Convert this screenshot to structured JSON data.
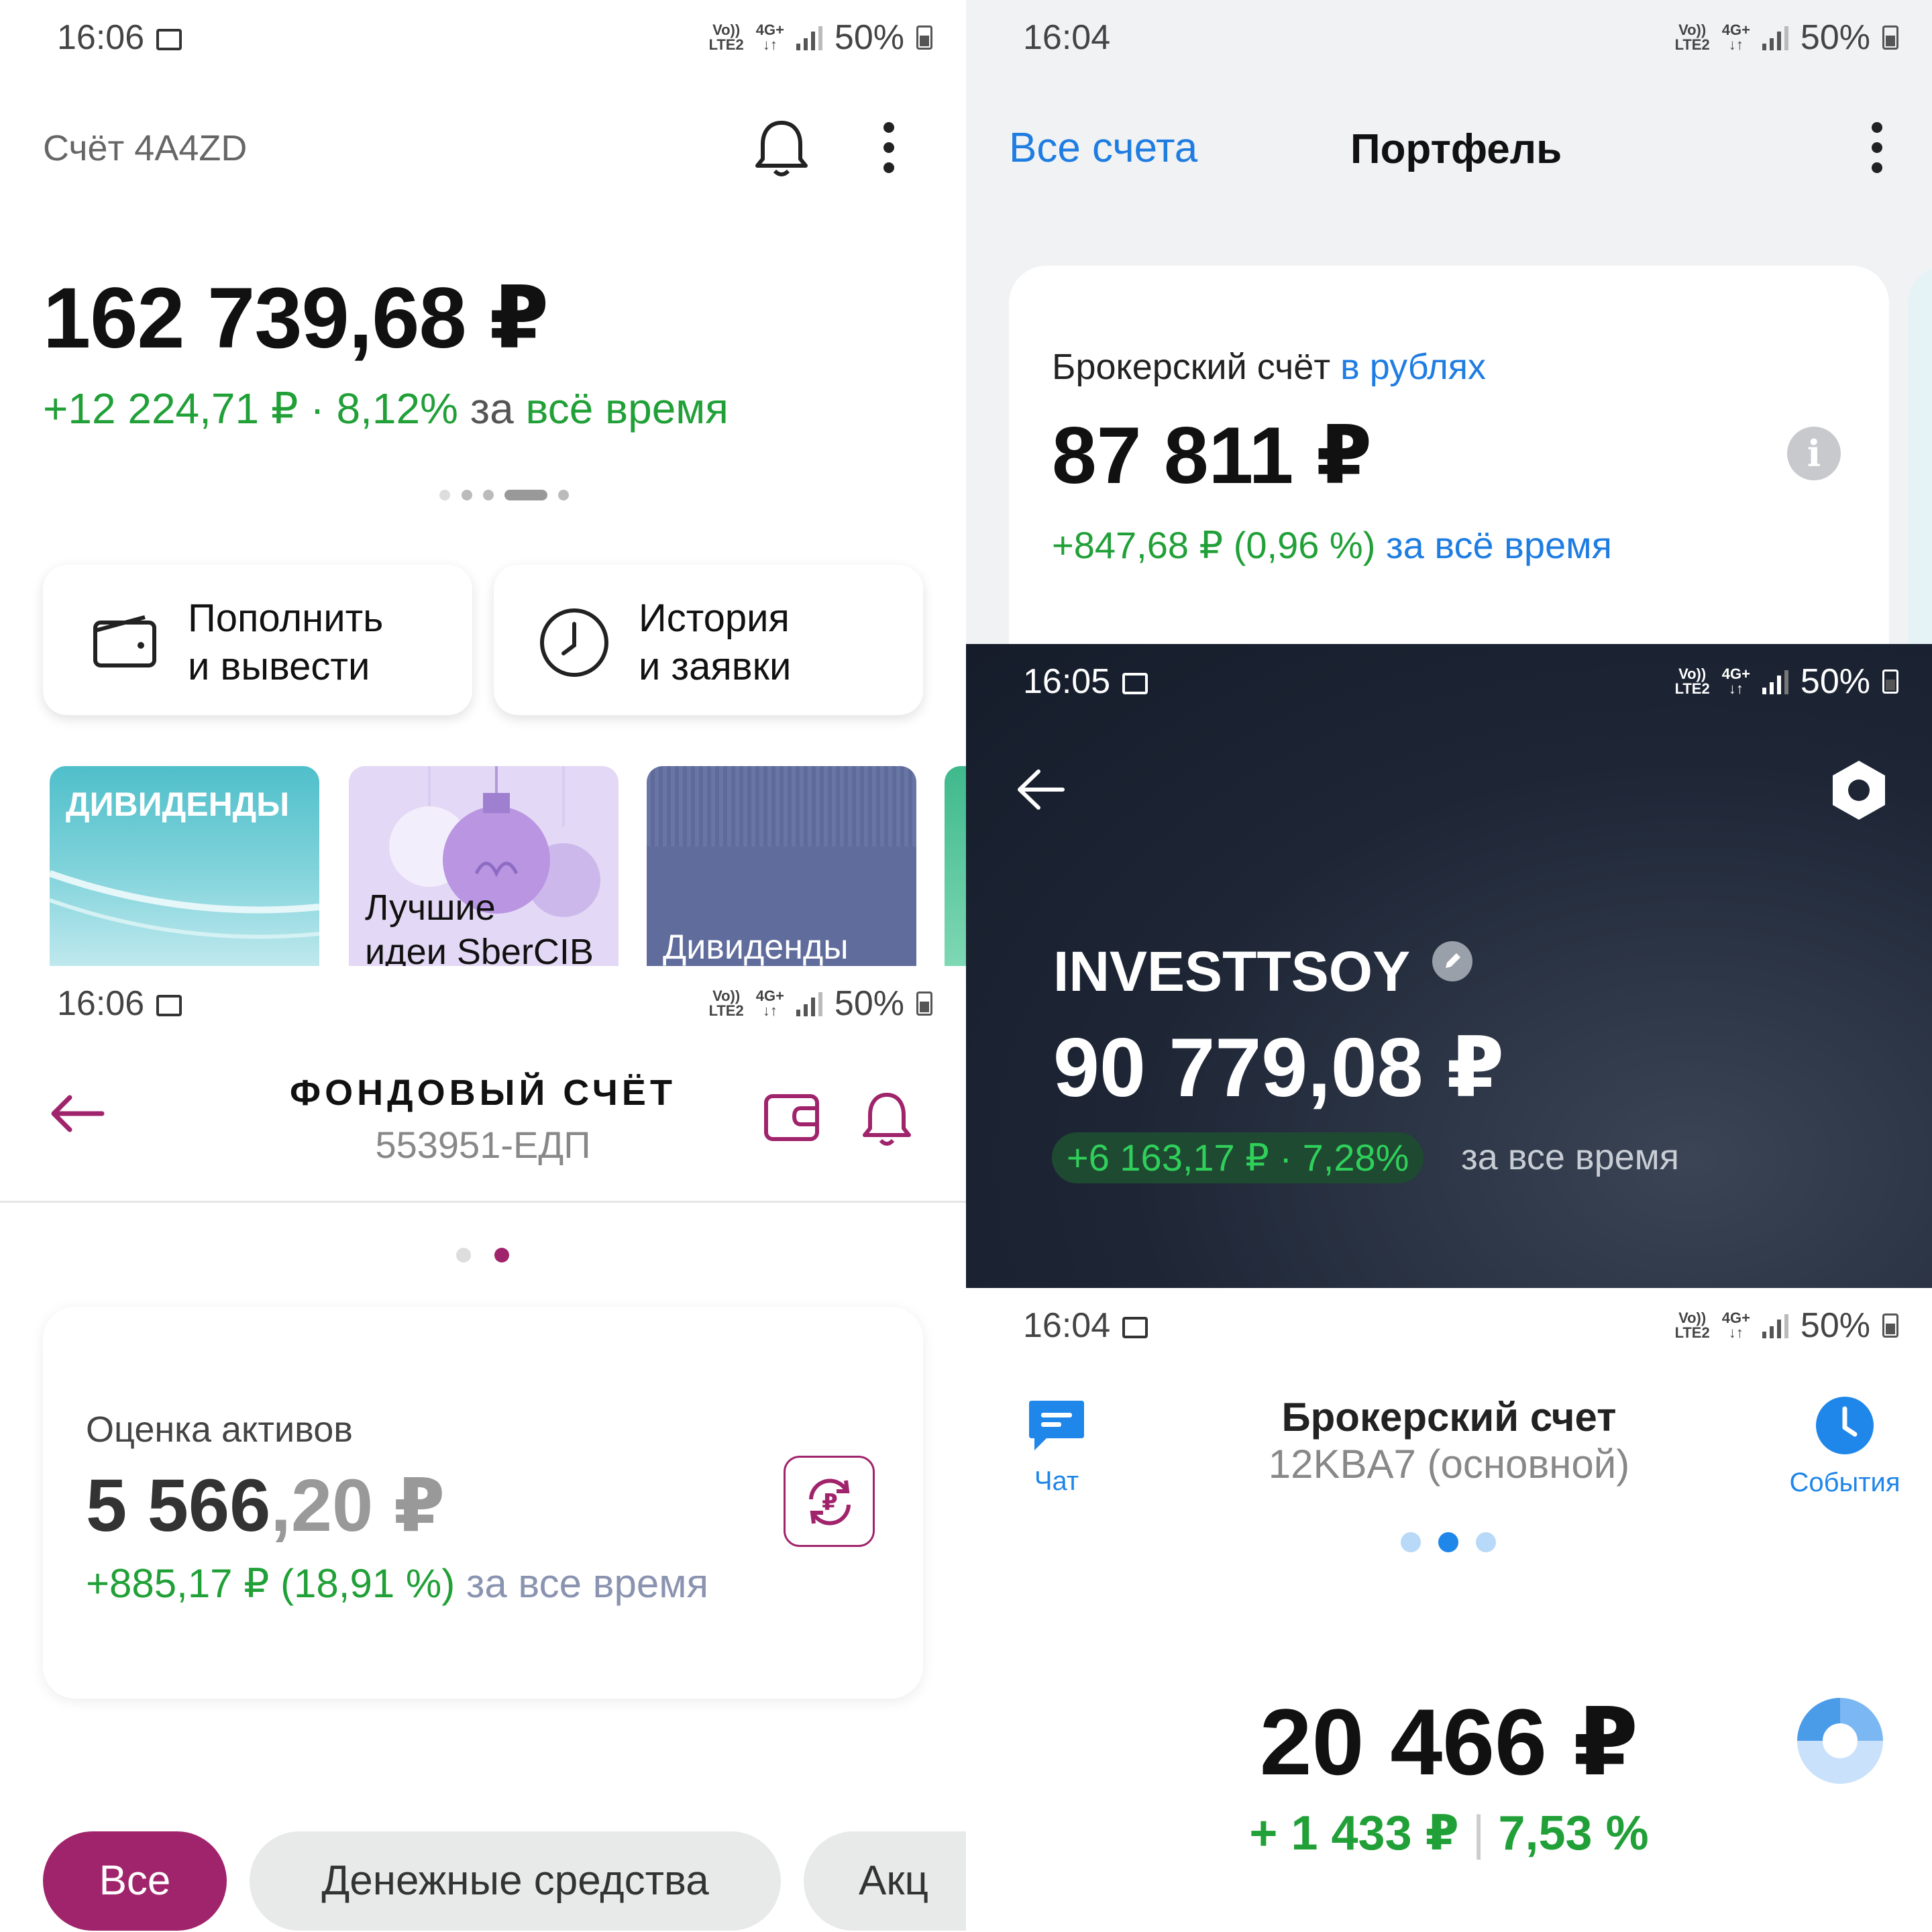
{
  "p1": {
    "time": "16:06",
    "battery": "50%",
    "net": {
      "volte": "Vo)) LTE2",
      "gen": "4G+"
    },
    "account_title": "Счёт 4A4ZD",
    "balance": "162 739,68 ₽",
    "change_value": "+12 224,71 ₽ · 8,12%",
    "change_mid": "за",
    "change_period": "всё время",
    "btn_deposit_line1": "Пополнить",
    "btn_deposit_line2": "и вывести",
    "btn_history_line1": "История",
    "btn_history_line2": "и заявки",
    "story1": "ДИВИДЕНДЫ",
    "story2_line1": "Лучшие",
    "story2_line2": "идеи SberCIB",
    "story3": "Дивиденды"
  },
  "p2": {
    "time": "16:04",
    "battery": "50%",
    "net": {
      "volte": "Vo)) LTE2",
      "gen": "4G+"
    },
    "all_accounts": "Все счета",
    "title": "Портфель",
    "card_label": "Брокерский счёт",
    "card_currency": "в рублях",
    "card_balance": "87 811 ₽",
    "card_change": "+847,68 ₽ (0,96 %)",
    "card_period": "за всё время"
  },
  "p3": {
    "time": "16:06",
    "battery": "50%",
    "net": {
      "volte": "Vo)) LTE2",
      "gen": "4G+"
    },
    "title": "ФОНДОВЫЙ СЧЁТ",
    "account_no": "553951-ЕДП",
    "assets_label": "Оценка активов",
    "balance_int": "5 566",
    "balance_frac": ",20 ₽",
    "change": "+885,17 ₽ (18,91 %)",
    "period": "за все время",
    "chips": [
      "Все",
      "Денежные средства",
      "Акц"
    ]
  },
  "p4": {
    "time": "16:05",
    "battery": "50%",
    "net": {
      "volte": "Vo)) LTE2",
      "gen": "4G+"
    },
    "name": "INVESTTSOY",
    "balance": "90 779,08 ₽",
    "change": "+6 163,17 ₽ · 7,28%",
    "period": "за все время"
  },
  "p5": {
    "time": "16:04",
    "battery": "50%",
    "net": {
      "volte": "Vo)) LTE2",
      "gen": "4G+"
    },
    "chat": "Чат",
    "events": "События",
    "title": "Брокерский счет",
    "subtitle": "12KBA7 (основной)",
    "balance": "20 466 ₽",
    "change_abs": "+ 1 433 ₽",
    "change_pct": "7,53 %"
  },
  "colors": {
    "green": "#21a038",
    "blue_link": "#1f7de2",
    "magenta": "#a0246c",
    "dark_bg": "#1c2433",
    "tinkoff_blue": "#1f86ea"
  }
}
